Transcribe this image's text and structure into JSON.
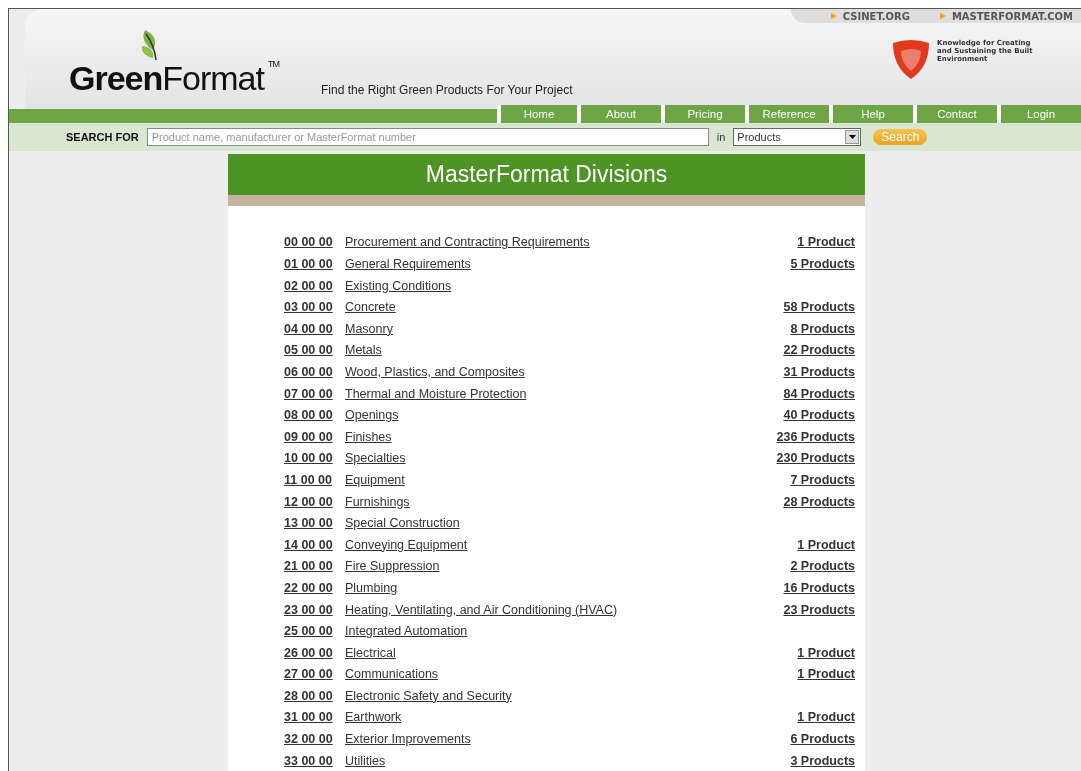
{
  "top_links": [
    "CSINET.ORG",
    "MASTERFORMAT.COM"
  ],
  "logo": {
    "bold_part": "Green",
    "rest": "Format",
    "mark": "TM"
  },
  "tagline": "Find the Right Green Products For Your Project",
  "csi_tagline": "Knowledge for Creating and Sustaining the Built Environment",
  "nav": [
    "Home",
    "About",
    "Pricing",
    "Reference",
    "Help",
    "Contact",
    "Login"
  ],
  "search": {
    "label": "SEARCH FOR",
    "placeholder": "Product name, manufacturer or MasterFormat number",
    "in_label": "in",
    "scope": "Products",
    "button": "Search"
  },
  "title": "MasterFormat Divisions",
  "divisions": [
    {
      "code": "00 00 00",
      "name": "Procurement and Contracting Requirements",
      "count": "1 Product"
    },
    {
      "code": "01 00 00",
      "name": "General Requirements",
      "count": "5 Products"
    },
    {
      "code": "02 00 00",
      "name": "Existing Conditions"
    },
    {
      "code": "03 00 00",
      "name": "Concrete",
      "count": "58 Products"
    },
    {
      "code": "04 00 00",
      "name": "Masonry",
      "count": "8 Products"
    },
    {
      "code": "05 00 00",
      "name": "Metals",
      "count": "22 Products"
    },
    {
      "code": "06 00 00",
      "name": "Wood, Plastics, and Composites",
      "count": "31 Products"
    },
    {
      "code": "07 00 00",
      "name": "Thermal and Moisture Protection",
      "count": "84 Products"
    },
    {
      "code": "08 00 00",
      "name": "Openings",
      "count": "40 Products"
    },
    {
      "code": "09 00 00",
      "name": "Finishes",
      "count": "236 Products"
    },
    {
      "code": "10 00 00",
      "name": "Specialties",
      "count": "230 Products"
    },
    {
      "code": "11 00 00",
      "name": "Equipment",
      "count": "7 Products"
    },
    {
      "code": "12 00 00",
      "name": "Furnishings",
      "count": "28 Products"
    },
    {
      "code": "13 00 00",
      "name": "Special Construction"
    },
    {
      "code": "14 00 00",
      "name": "Conveying Equipment",
      "count": "1 Product"
    },
    {
      "code": "21 00 00",
      "name": "Fire Suppression",
      "count": "2 Products"
    },
    {
      "code": "22 00 00",
      "name": "Plumbing",
      "count": "16 Products"
    },
    {
      "code": "23 00 00",
      "name": "Heating, Ventilating, and Air Conditioning (HVAC)",
      "count": "23 Products"
    },
    {
      "code": "25 00 00",
      "name": "Integrated Automation"
    },
    {
      "code": "26 00 00",
      "name": "Electrical",
      "count": "1 Product"
    },
    {
      "code": "27 00 00",
      "name": "Communications",
      "count": "1 Product"
    },
    {
      "code": "28 00 00",
      "name": "Electronic Safety and Security"
    },
    {
      "code": "31 00 00",
      "name": "Earthwork",
      "count": "1 Product"
    },
    {
      "code": "32 00 00",
      "name": "Exterior Improvements",
      "count": "6 Products"
    },
    {
      "code": "33 00 00",
      "name": "Utilities",
      "count": "3 Products"
    }
  ]
}
